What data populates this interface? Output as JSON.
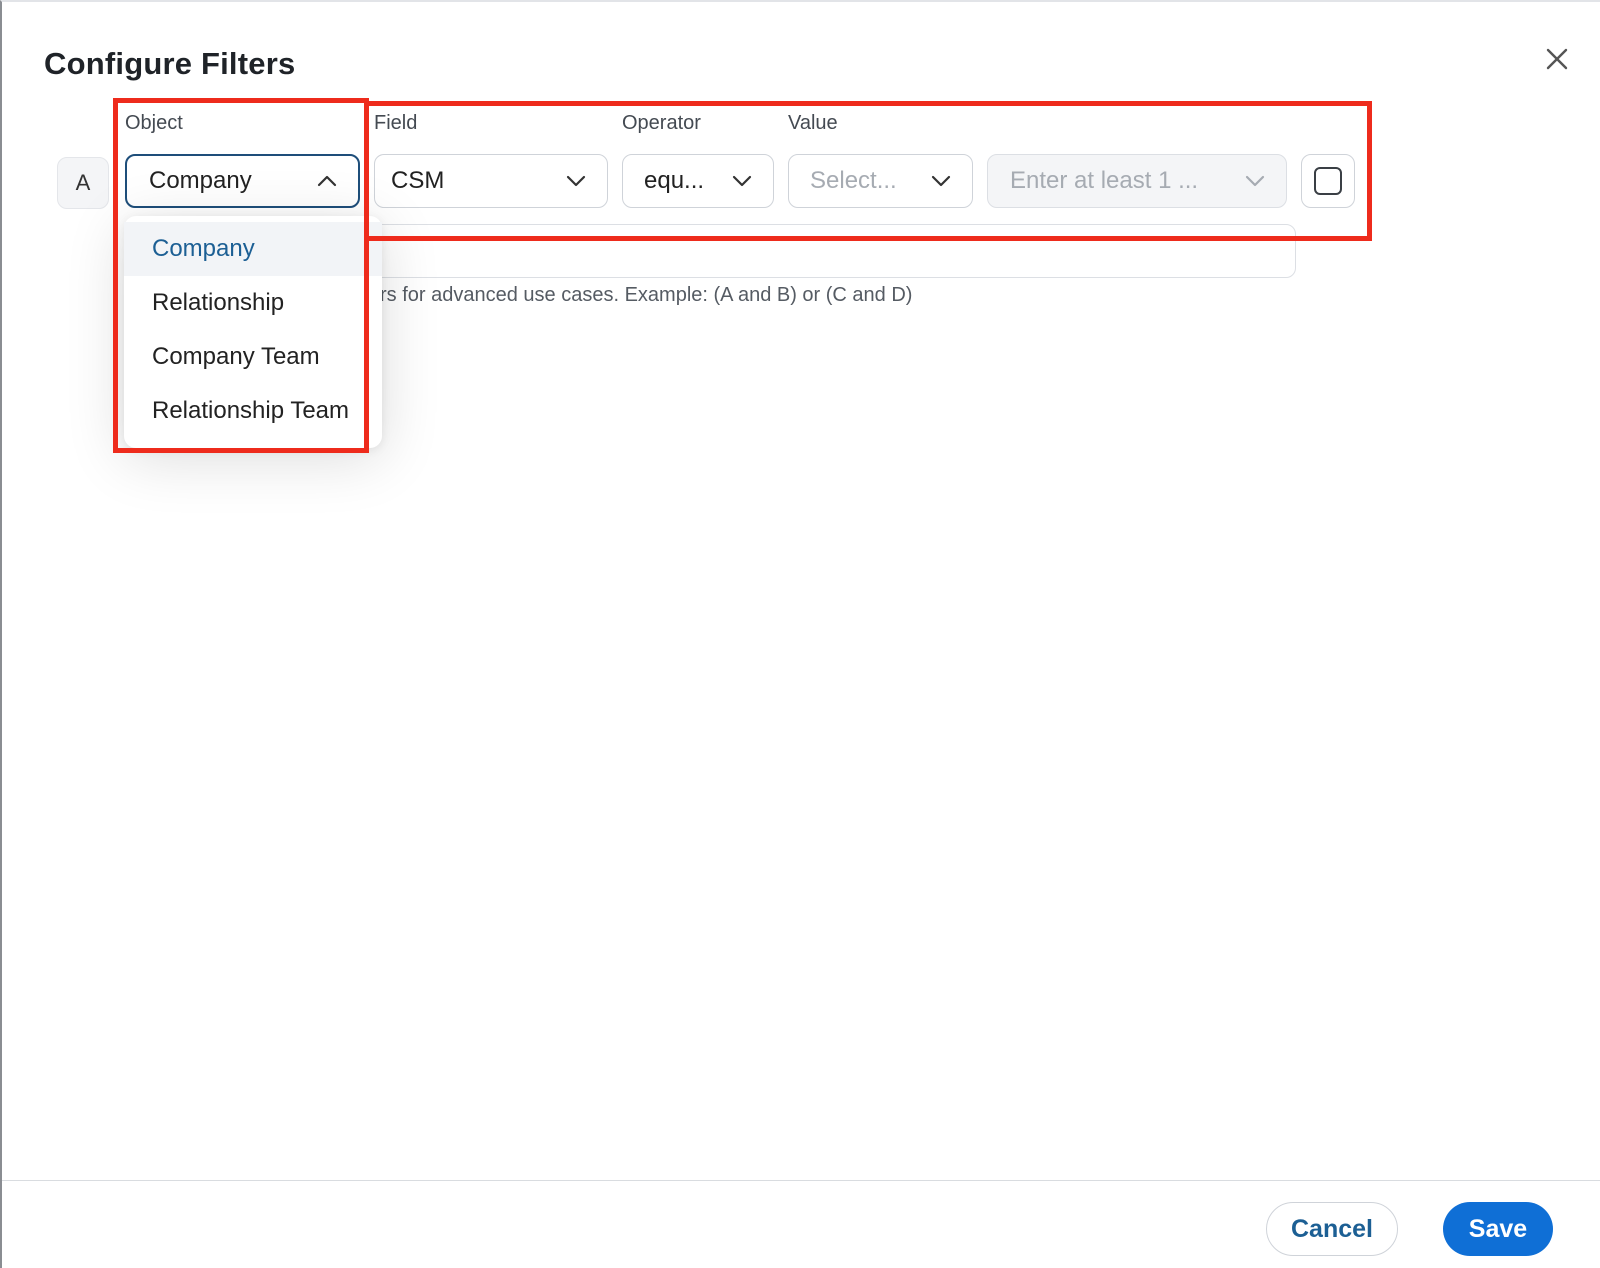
{
  "dialog": {
    "title": "Configure Filters"
  },
  "columns": {
    "object_label": "Object",
    "field_label": "Field",
    "operator_label": "Operator",
    "value_label": "Value"
  },
  "filter_row": {
    "letter": "A",
    "object_value": "Company",
    "field_value": "CSM",
    "operator_value": "equ...",
    "value_placeholder": "Select...",
    "value_input_placeholder": "Enter at least 1 ..."
  },
  "object_dropdown": {
    "items": [
      {
        "label": "Company",
        "selected": true
      },
      {
        "label": "Relationship",
        "selected": false
      },
      {
        "label": "Company Team",
        "selected": false
      },
      {
        "label": "Relationship Team",
        "selected": false
      }
    ]
  },
  "advanced": {
    "helper_text": "rs for advanced use cases. Example: (A and B) or (C and D)"
  },
  "footer": {
    "cancel_label": "Cancel",
    "save_label": "Save"
  },
  "colors": {
    "accent": "#0f6fd6",
    "link_text": "#1c5f94",
    "highlight_annotation": "#ee2b1c"
  },
  "icons": {
    "close": "close-icon",
    "dropdown_open": "chevron-up-icon",
    "dropdown_closed": "chevron-down-icon"
  }
}
